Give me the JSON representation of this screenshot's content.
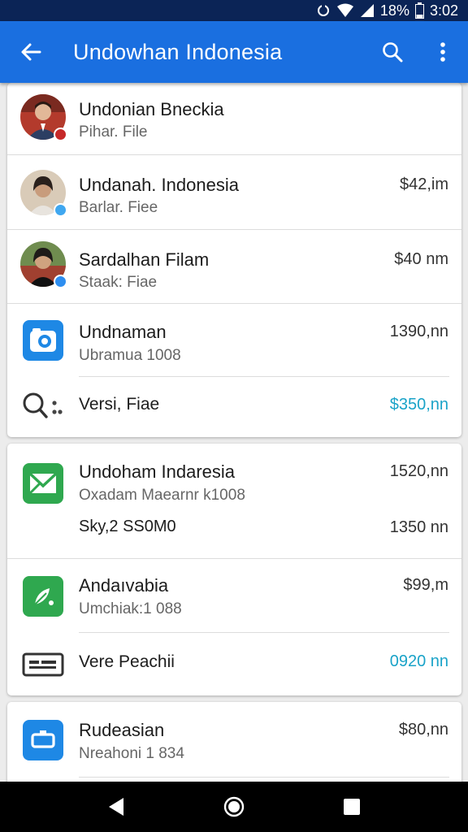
{
  "status": {
    "battery": "18%",
    "time": "3:02"
  },
  "app_bar": {
    "title": "Undowhan Indonesia"
  },
  "cards": [
    {
      "rows": [
        {
          "title": "Undonian Bneckia",
          "subtitle": "Pihar. File",
          "amount": ""
        },
        {
          "title": "Undanah. Indonesia",
          "subtitle": "Barlar. Fiee",
          "amount": "$42,im"
        },
        {
          "title": "Sardalhan Filam",
          "subtitle": "Staak: Fiae",
          "amount": "$40 nm"
        },
        {
          "title": "Undnaman",
          "subtitle": "Ubramua 1008",
          "amount": "1390,nn"
        },
        {
          "title": "Versi, Fiae",
          "amount": "$350,nn"
        }
      ]
    },
    {
      "rows": [
        {
          "title": "Undoham Indaresia",
          "subtitle": "Oxadam Maearnr k1008",
          "amount": "1520,nn"
        },
        {
          "title": "Sky,2 SS0M0",
          "amount": "1350 nn"
        },
        {
          "title": "Andaıvabia",
          "subtitle": "Umchiak:1 088",
          "amount": "$99,m"
        },
        {
          "title": "Vere Peachii",
          "amount": "0920 nn"
        }
      ]
    },
    {
      "rows": [
        {
          "title": "Rudeasian",
          "subtitle": "Nreahoni 1 834",
          "amount": "$80,nn"
        }
      ]
    }
  ],
  "colors": {
    "app_bar": "#1a6fe0",
    "status_bar": "#0b2456",
    "accent_amount": "#1aa3c8"
  }
}
